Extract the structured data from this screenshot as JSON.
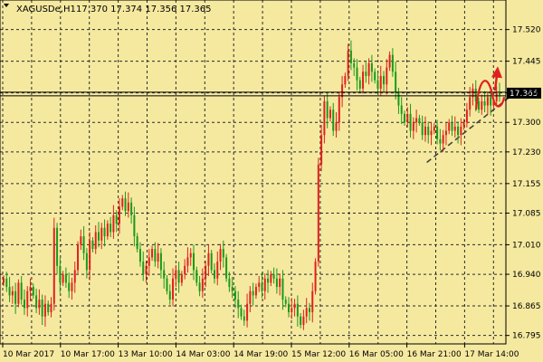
{
  "header": {
    "symbol": "XAGUSDe,H1",
    "ohlc": "17.370 17.374 17.356 17.365"
  },
  "chart_data": {
    "type": "candlestick",
    "symbol": "XAGUSDe",
    "timeframe": "H1",
    "current_price": 17.365,
    "current_price_label": "17.365",
    "ylim": [
      16.775,
      17.59
    ],
    "y_ticks": [
      "17.520",
      "17.445",
      "17.370",
      "17.300",
      "17.230",
      "17.155",
      "17.085",
      "17.010",
      "16.940",
      "16.865",
      "16.795"
    ],
    "x_ticks": [
      "10 Mar 2017",
      "10 Mar 17:00",
      "13 Mar 10:00",
      "14 Mar 03:00",
      "14 Mar 19:00",
      "15 Mar 12:00",
      "16 Mar 05:00",
      "16 Mar 21:00",
      "17 Mar 14:00"
    ],
    "grid": true,
    "colors": {
      "background": "#f5e9a0",
      "bull": "#e02020",
      "bear": "#1a9a1a",
      "grid": "#2a2a2a",
      "price_line": "#000000",
      "badge": "#000000",
      "trendline": "#444444",
      "forecast": "#e02020"
    },
    "close_series": [
      16.93,
      16.91,
      16.89,
      16.9,
      16.87,
      16.92,
      16.88,
      16.86,
      16.9,
      16.91,
      16.89,
      16.86,
      16.88,
      16.84,
      16.87,
      16.85,
      16.87,
      17.05,
      16.96,
      16.92,
      16.94,
      16.92,
      16.9,
      16.92,
      16.95,
      17.01,
      17.03,
      16.99,
      16.95,
      17.02,
      17.0,
      17.04,
      17.02,
      17.05,
      17.03,
      17.06,
      17.04,
      17.08,
      17.06,
      17.1,
      17.12,
      17.09,
      17.11,
      17.08,
      17.03,
      17.0,
      16.97,
      16.94,
      16.96,
      16.98,
      17.0,
      16.97,
      16.99,
      16.95,
      16.93,
      16.9,
      16.88,
      16.93,
      16.95,
      16.92,
      16.94,
      16.96,
      16.98,
      16.99,
      16.95,
      16.92,
      16.9,
      16.93,
      16.96,
      16.99,
      16.95,
      16.93,
      16.97,
      17.0,
      16.98,
      16.93,
      16.91,
      16.9,
      16.88,
      16.86,
      16.84,
      16.83,
      16.87,
      16.9,
      16.89,
      16.91,
      16.92,
      16.9,
      16.93,
      16.92,
      16.94,
      16.93,
      16.91,
      16.93,
      16.88,
      16.87,
      16.85,
      16.86,
      16.87,
      16.84,
      16.82,
      16.84,
      16.86,
      16.85,
      16.9,
      16.97,
      17.2,
      17.27,
      17.35,
      17.31,
      17.33,
      17.28,
      17.3,
      17.36,
      17.39,
      17.41,
      17.47,
      17.44,
      17.43,
      17.4,
      17.38,
      17.42,
      17.41,
      17.44,
      17.42,
      17.4,
      17.38,
      17.41,
      17.39,
      17.43,
      17.46,
      17.42,
      17.37,
      17.34,
      17.32,
      17.3,
      17.32,
      17.28,
      17.3,
      17.31,
      17.3,
      17.27,
      17.29,
      17.27,
      17.28,
      17.29,
      17.26,
      17.25,
      17.27,
      17.28,
      17.3,
      17.28,
      17.29,
      17.27,
      17.29,
      17.3,
      17.33,
      17.36,
      17.38,
      17.35,
      17.33,
      17.35,
      17.34,
      17.36,
      17.34,
      17.35,
      17.37,
      17.365
    ],
    "trendline": [
      {
        "x": "16 Mar 21:00",
        "y": 17.205
      },
      {
        "x": "17 Mar 14:00",
        "y": 17.36
      }
    ],
    "forecast_arrow_target": 17.42
  }
}
